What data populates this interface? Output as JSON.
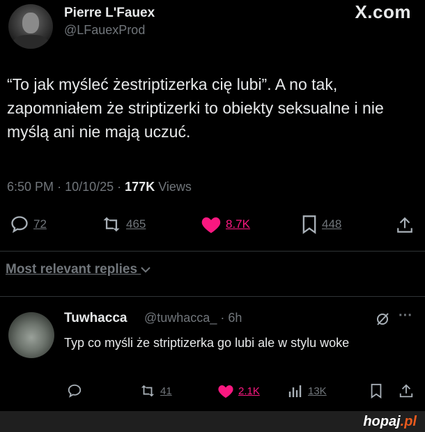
{
  "author": {
    "name": "Pierre L'Fauex",
    "handle": "@LFauexProd"
  },
  "brand": "X.com",
  "tweet": {
    "text": "“To jak myśleć żestriptizerka cię lubi”. A no tak, zapomniałem że striptizerki to obiekty seksualne i nie myślą ani nie mają uczuć.",
    "time": "6:50 PM",
    "date": "10/10/25",
    "views_count": "177K",
    "views_label": "Views",
    "actions": {
      "replies": "72",
      "reposts": "465",
      "likes": "8.7K",
      "bookmarks": "448"
    }
  },
  "replies_filter": "Most relevant replies",
  "reply": {
    "name": "Tuwhacca",
    "handle": "@tuwhacca_",
    "age": "6h",
    "text": "Typ co myśli że striptizerka go lubi ale w stylu woke",
    "actions": {
      "reposts": "41",
      "likes": "2.1K",
      "views": "13K"
    }
  },
  "watermark": {
    "main": "hopaj",
    "suffix": ".pl"
  },
  "colors": {
    "background": "#000000",
    "text": "#e7e9ea",
    "muted": "#71767b",
    "like": "#f91880"
  },
  "icons": [
    "reply-icon",
    "repost-icon",
    "like-icon",
    "bookmark-icon",
    "share-icon",
    "chevron-down-icon",
    "grok-icon",
    "more-icon",
    "views-icon"
  ]
}
